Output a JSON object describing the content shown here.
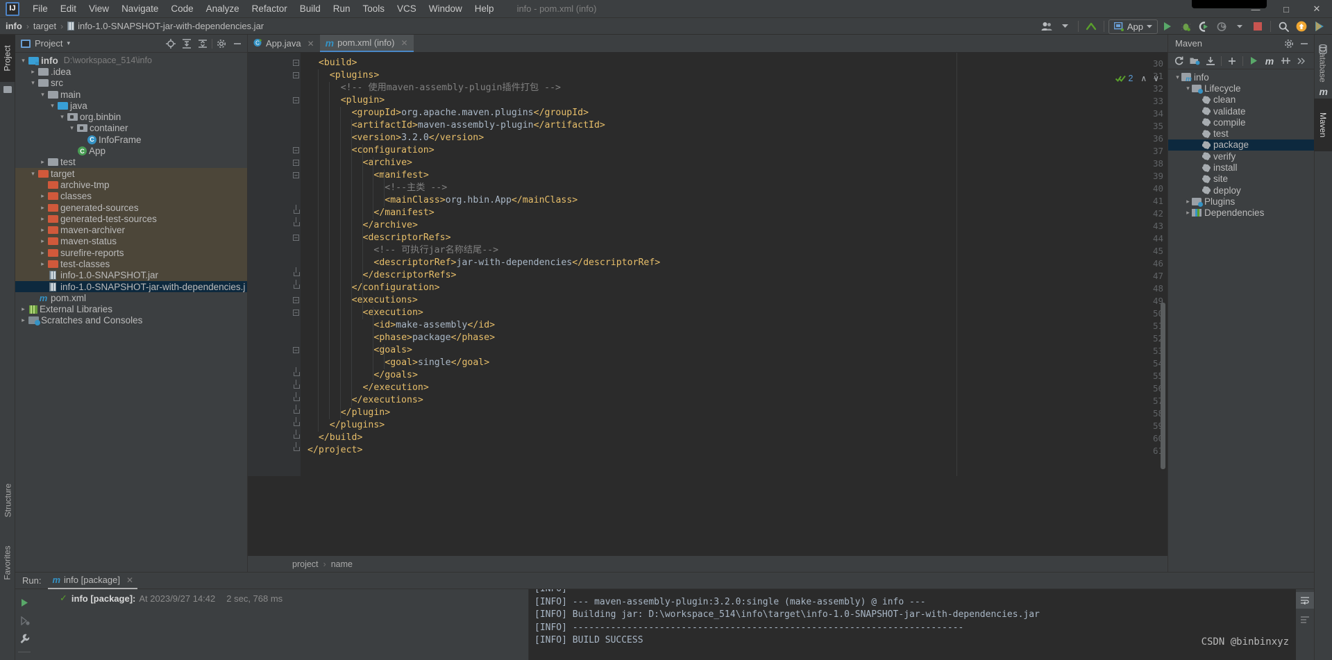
{
  "window": {
    "title": "info - pom.xml (info)",
    "controls": {
      "minimize": "—",
      "maximize": "□",
      "close": "✕"
    }
  },
  "menubar": {
    "logo": "IJ",
    "items": [
      "File",
      "Edit",
      "View",
      "Navigate",
      "Code",
      "Analyze",
      "Refactor",
      "Build",
      "Run",
      "Tools",
      "VCS",
      "Window",
      "Help"
    ]
  },
  "navbar": {
    "crumbs": [
      "info",
      "target",
      "info-1.0-SNAPSHOT-jar-with-dependencies.jar"
    ],
    "separator": "›"
  },
  "toolbar": {
    "run_config": "App",
    "icons": [
      "user-avatar-icon",
      "updates-arrow-icon",
      "run-icon",
      "debug-icon",
      "run-coverage-icon",
      "profile-icon",
      "stop-icon",
      "search-icon",
      "update-project-icon",
      "ide-features-icon"
    ]
  },
  "project_panel": {
    "title": "Project",
    "dropdown_caret": "▾",
    "header_icons": [
      "locate-icon",
      "expand-all-icon",
      "collapse-all-icon",
      "settings-gear-icon",
      "hide-icon"
    ],
    "tree": [
      {
        "indent": 0,
        "chev": "⌄",
        "icon": "module-folder",
        "label": "info",
        "bold": true,
        "sub": "D:\\workspace_514\\info",
        "style": ""
      },
      {
        "indent": 1,
        "chev": "›",
        "icon": "folder-grey",
        "label": ".idea",
        "style": ""
      },
      {
        "indent": 1,
        "chev": "⌄",
        "icon": "folder-grey",
        "label": "src",
        "style": ""
      },
      {
        "indent": 2,
        "chev": "⌄",
        "icon": "folder-grey",
        "label": "main",
        "style": ""
      },
      {
        "indent": 3,
        "chev": "⌄",
        "icon": "folder-blue",
        "label": "java",
        "style": ""
      },
      {
        "indent": 4,
        "chev": "⌄",
        "icon": "package",
        "label": "org.binbin",
        "style": ""
      },
      {
        "indent": 5,
        "chev": "⌄",
        "icon": "package",
        "label": "container",
        "style": ""
      },
      {
        "indent": 6,
        "chev": "",
        "icon": "class",
        "label": "InfoFrame",
        "style": ""
      },
      {
        "indent": 5,
        "chev": "",
        "icon": "class-runnable",
        "label": "App",
        "style": ""
      },
      {
        "indent": 2,
        "chev": "›",
        "icon": "folder-grey",
        "label": "test",
        "style": ""
      },
      {
        "indent": 1,
        "chev": "⌄",
        "icon": "folder-orange",
        "label": "target",
        "style": "target-hl"
      },
      {
        "indent": 2,
        "chev": "",
        "icon": "folder-orange",
        "label": "archive-tmp",
        "style": "target-hl"
      },
      {
        "indent": 2,
        "chev": "›",
        "icon": "folder-orange",
        "label": "classes",
        "style": "target-hl"
      },
      {
        "indent": 2,
        "chev": "›",
        "icon": "folder-orange",
        "label": "generated-sources",
        "style": "target-hl"
      },
      {
        "indent": 2,
        "chev": "›",
        "icon": "folder-orange",
        "label": "generated-test-sources",
        "style": "target-hl"
      },
      {
        "indent": 2,
        "chev": "›",
        "icon": "folder-orange",
        "label": "maven-archiver",
        "style": "target-hl"
      },
      {
        "indent": 2,
        "chev": "›",
        "icon": "folder-orange",
        "label": "maven-status",
        "style": "target-hl"
      },
      {
        "indent": 2,
        "chev": "›",
        "icon": "folder-orange",
        "label": "surefire-reports",
        "style": "target-hl"
      },
      {
        "indent": 2,
        "chev": "›",
        "icon": "folder-orange",
        "label": "test-classes",
        "style": "target-hl"
      },
      {
        "indent": 2,
        "chev": "",
        "icon": "jar",
        "label": "info-1.0-SNAPSHOT.jar",
        "style": "target-hl"
      },
      {
        "indent": 2,
        "chev": "",
        "icon": "jar",
        "label": "info-1.0-SNAPSHOT-jar-with-dependencies.j",
        "style": "selected"
      },
      {
        "indent": 1,
        "chev": "",
        "icon": "maven",
        "label": "pom.xml",
        "style": ""
      },
      {
        "indent": 0,
        "chev": "›",
        "icon": "libraries",
        "label": "External Libraries",
        "style": ""
      },
      {
        "indent": 0,
        "chev": "›",
        "icon": "scratches",
        "label": "Scratches and Consoles",
        "style": ""
      }
    ]
  },
  "left_strip": {
    "project_tab": "Project",
    "structure_tab": "Structure",
    "favorites_tab": "Favorites"
  },
  "editor": {
    "tabs": [
      {
        "label": "App.java",
        "icon": "java-class-icon",
        "active": false
      },
      {
        "label": "pom.xml (info)",
        "icon": "maven-icon",
        "active": true
      }
    ],
    "inspection_widget": {
      "count": "2",
      "up": "∧",
      "down": "∨"
    },
    "breadcrumb": [
      "project",
      "name"
    ],
    "lines": [
      {
        "n": 30,
        "indent": 1,
        "fold": "open",
        "code": "<build>"
      },
      {
        "n": 31,
        "indent": 2,
        "fold": "open",
        "code": "<plugins>"
      },
      {
        "n": 32,
        "indent": 3,
        "fold": "",
        "code": "<!-- 使用maven-assembly-plugin插件打包 -->",
        "comment": true
      },
      {
        "n": 33,
        "indent": 3,
        "fold": "open",
        "code": "<plugin>"
      },
      {
        "n": 34,
        "indent": 4,
        "fold": "",
        "code": "<groupId>org.apache.maven.plugins</groupId>"
      },
      {
        "n": 35,
        "indent": 4,
        "fold": "",
        "code": "<artifactId>maven-assembly-plugin</artifactId>"
      },
      {
        "n": 36,
        "indent": 4,
        "fold": "",
        "code": "<version>3.2.0</version>"
      },
      {
        "n": 37,
        "indent": 4,
        "fold": "open",
        "code": "<configuration>"
      },
      {
        "n": 38,
        "indent": 5,
        "fold": "open",
        "code": "<archive>"
      },
      {
        "n": 39,
        "indent": 6,
        "fold": "open",
        "code": "<manifest>"
      },
      {
        "n": 40,
        "indent": 7,
        "fold": "",
        "code": "<!--主类 -->",
        "comment": true
      },
      {
        "n": 41,
        "indent": 7,
        "fold": "",
        "code": "<mainClass>org.hbin.App</mainClass>"
      },
      {
        "n": 42,
        "indent": 6,
        "fold": "close",
        "code": "</manifest>"
      },
      {
        "n": 43,
        "indent": 5,
        "fold": "close",
        "code": "</archive>"
      },
      {
        "n": 44,
        "indent": 5,
        "fold": "open",
        "code": "<descriptorRefs>"
      },
      {
        "n": 45,
        "indent": 6,
        "fold": "",
        "code": "<!-- 可执行jar名称结尾-->",
        "comment": true
      },
      {
        "n": 46,
        "indent": 6,
        "fold": "",
        "code": "<descriptorRef>jar-with-dependencies</descriptorRef>"
      },
      {
        "n": 47,
        "indent": 5,
        "fold": "close",
        "code": "</descriptorRefs>"
      },
      {
        "n": 48,
        "indent": 4,
        "fold": "close",
        "code": "</configuration>"
      },
      {
        "n": 49,
        "indent": 4,
        "fold": "open",
        "code": "<executions>"
      },
      {
        "n": 50,
        "indent": 5,
        "fold": "open",
        "code": "<execution>"
      },
      {
        "n": 51,
        "indent": 6,
        "fold": "",
        "code": "<id>make-assembly</id>"
      },
      {
        "n": 52,
        "indent": 6,
        "fold": "",
        "code": "<phase>package</phase>"
      },
      {
        "n": 53,
        "indent": 6,
        "fold": "open",
        "code": "<goals>"
      },
      {
        "n": 54,
        "indent": 7,
        "fold": "",
        "code": "<goal>single</goal>"
      },
      {
        "n": 55,
        "indent": 6,
        "fold": "close",
        "code": "</goals>"
      },
      {
        "n": 56,
        "indent": 5,
        "fold": "close",
        "code": "</execution>"
      },
      {
        "n": 57,
        "indent": 4,
        "fold": "close",
        "code": "</executions>"
      },
      {
        "n": 58,
        "indent": 3,
        "fold": "close",
        "code": "</plugin>"
      },
      {
        "n": 59,
        "indent": 2,
        "fold": "close",
        "code": "</plugins>"
      },
      {
        "n": 60,
        "indent": 1,
        "fold": "close",
        "code": "</build>"
      },
      {
        "n": 61,
        "indent": 0,
        "fold": "close",
        "code": "</project>"
      }
    ]
  },
  "maven_panel": {
    "title": "Maven",
    "header_icons": [
      "settings-gear-icon",
      "hide-icon"
    ],
    "toolbar_icons": [
      "reload-icon",
      "add-maven-project-icon",
      "download-sources-icon",
      "add-icon",
      "run-icon",
      "execute-maven-goal-icon",
      "toggle-skip-tests-icon",
      "more-icon"
    ],
    "tree": [
      {
        "indent": 0,
        "chev": "⌄",
        "icon": "maven-module",
        "label": "info",
        "selected": false
      },
      {
        "indent": 1,
        "chev": "⌄",
        "icon": "lifecycle-folder",
        "label": "Lifecycle",
        "selected": false
      },
      {
        "indent": 2,
        "chev": "",
        "icon": "gear",
        "label": "clean",
        "selected": false
      },
      {
        "indent": 2,
        "chev": "",
        "icon": "gear",
        "label": "validate",
        "selected": false
      },
      {
        "indent": 2,
        "chev": "",
        "icon": "gear",
        "label": "compile",
        "selected": false
      },
      {
        "indent": 2,
        "chev": "",
        "icon": "gear",
        "label": "test",
        "selected": false
      },
      {
        "indent": 2,
        "chev": "",
        "icon": "gear",
        "label": "package",
        "selected": true
      },
      {
        "indent": 2,
        "chev": "",
        "icon": "gear",
        "label": "verify",
        "selected": false
      },
      {
        "indent": 2,
        "chev": "",
        "icon": "gear",
        "label": "install",
        "selected": false
      },
      {
        "indent": 2,
        "chev": "",
        "icon": "gear",
        "label": "site",
        "selected": false
      },
      {
        "indent": 2,
        "chev": "",
        "icon": "gear",
        "label": "deploy",
        "selected": false
      },
      {
        "indent": 1,
        "chev": "›",
        "icon": "lifecycle-folder",
        "label": "Plugins",
        "selected": false
      },
      {
        "indent": 1,
        "chev": "›",
        "icon": "dependencies",
        "label": "Dependencies",
        "selected": false
      }
    ]
  },
  "right_strip": {
    "tabs": [
      "Database",
      "Maven"
    ],
    "active": "Maven"
  },
  "run_panel": {
    "label": "Run:",
    "tab": "info [package]",
    "tab_close": "✕",
    "side_icons": [
      "rerun-icon",
      "rerun-failed-icon",
      "settings-wrench-icon"
    ],
    "tree_entry": {
      "check": "✓",
      "name": "info [package]:",
      "at": "At 2023/9/27 14:42",
      "duration": "2 sec, 768 ms"
    },
    "console_lines": [
      "[INFO]",
      "[INFO] --- maven-assembly-plugin:3.2.0:single (make-assembly) @ info ---",
      "[INFO] Building jar: D:\\workspace_514\\info\\target\\info-1.0-SNAPSHOT-jar-with-dependencies.jar",
      "[INFO] ------------------------------------------------------------------------",
      "[INFO] BUILD SUCCESS"
    ],
    "console_right_icons": [
      "soft-wrap-icon"
    ],
    "watermark": "CSDN @binbinxyz"
  },
  "colors": {
    "accent_blue": "#4a88c7",
    "selection": "#0d293e",
    "target_highlight": "#4c4639",
    "editor_bg": "#2b2b2b",
    "panel_bg": "#3c3f41",
    "tag": "#e8bf6a",
    "text": "#a9b7c6",
    "comment": "#808080",
    "folder_orange": "#d1593b",
    "folder_blue": "#389fd6",
    "success_green": "#499c54"
  }
}
